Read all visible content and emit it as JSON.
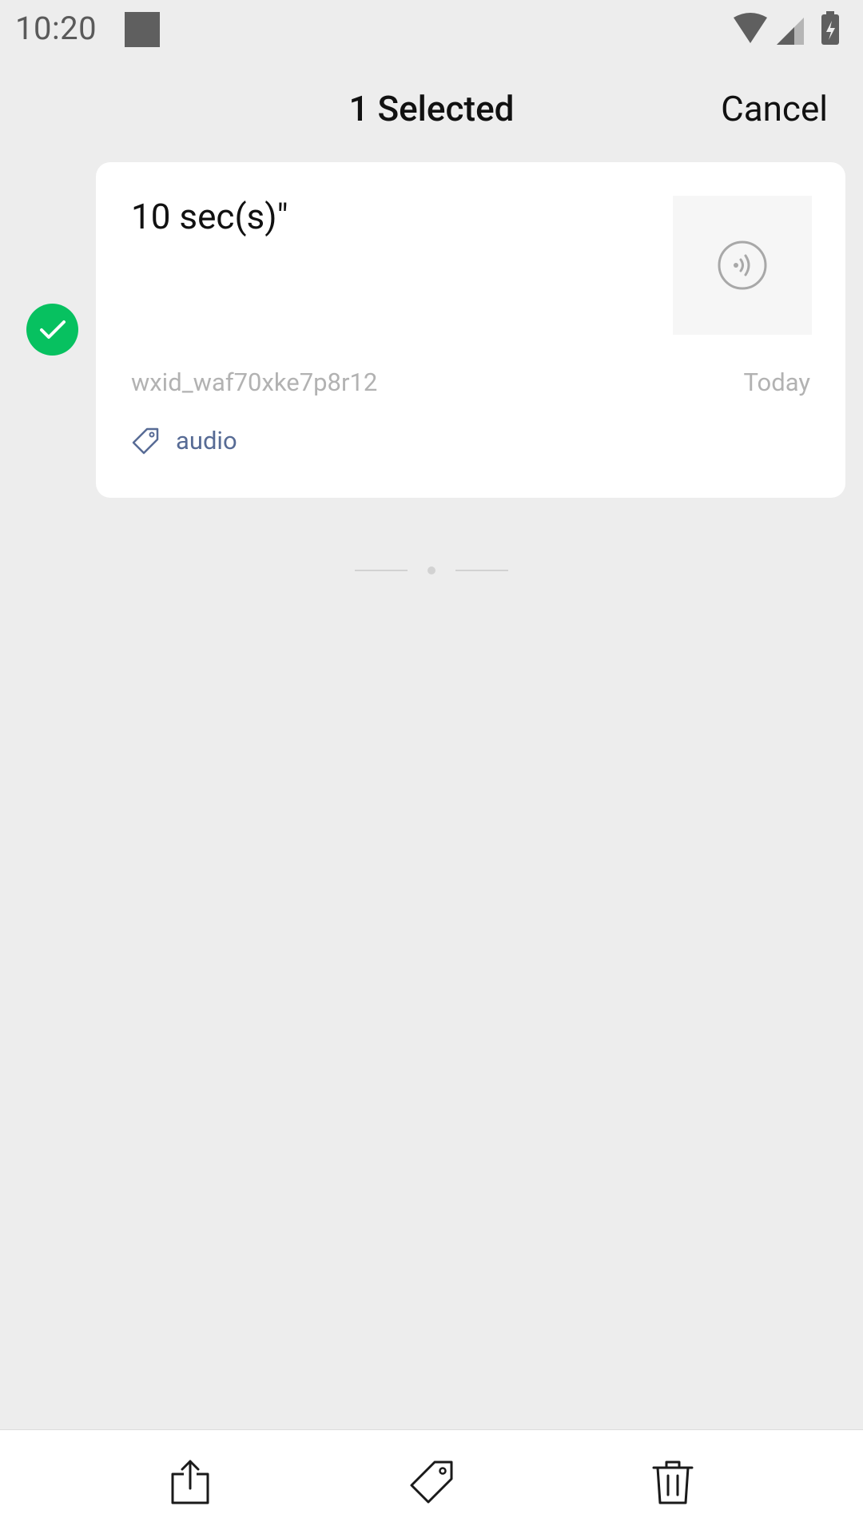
{
  "status_bar": {
    "time": "10:20"
  },
  "header": {
    "title": "1 Selected",
    "cancel_label": "Cancel"
  },
  "item": {
    "selected": true,
    "title": "10 sec(s)\"",
    "source": "wxid_waf70xke7p8r12",
    "date": "Today",
    "tag": "audio",
    "thumb_icon": "audio-wave-icon"
  },
  "bottom_bar": {
    "actions": [
      "share-icon",
      "tag-icon",
      "trash-icon"
    ]
  },
  "colors": {
    "background": "#ededed",
    "accent_green": "#07c160",
    "tag_link": "#576b95",
    "muted_text": "#b2b2b2"
  }
}
